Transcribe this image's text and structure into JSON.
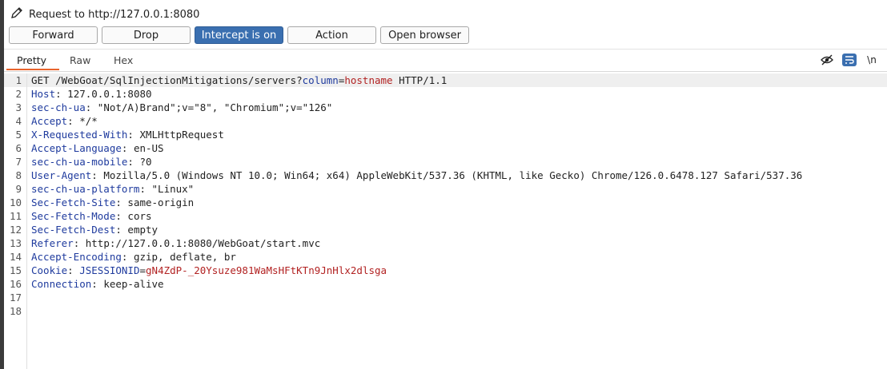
{
  "title": "Request to http://127.0.0.1:8080",
  "toolbar": {
    "buttons": [
      {
        "label": "Forward"
      },
      {
        "label": "Drop"
      },
      {
        "label": "Intercept is on"
      },
      {
        "label": "Action"
      },
      {
        "label": "Open browser"
      }
    ]
  },
  "tabs": [
    {
      "label": "Pretty"
    },
    {
      "label": "Raw"
    },
    {
      "label": "Hex"
    }
  ],
  "icons": {
    "eye_off": "eye-off-icon",
    "wrap": "word-wrap-icon",
    "newline_label": "\\n"
  },
  "colors": {
    "accent": "#e8642c",
    "intercept_button": "#3a6fb0",
    "header_key": "#1f3b9e",
    "param_value": "#b22222"
  },
  "editor": {
    "line_numbers": [
      "1",
      "2",
      "3",
      "4",
      "5",
      "6",
      "7",
      "8",
      "9",
      "10",
      "11",
      "12",
      "13",
      "14",
      "15",
      "16",
      "17",
      "18"
    ],
    "request_line": {
      "method_path": "GET /WebGoat/SqlInjectionMitigations/servers?",
      "param_name": "column",
      "eq": "=",
      "param_value": "hostname",
      "protocol": " HTTP/1.1"
    },
    "headers": [
      {
        "key": "Host",
        "value": "127.0.0.1:8080"
      },
      {
        "key": "sec-ch-ua",
        "value": "\"Not/A)Brand\";v=\"8\", \"Chromium\";v=\"126\""
      },
      {
        "key": "Accept",
        "value": "*/*"
      },
      {
        "key": "X-Requested-With",
        "value": "XMLHttpRequest"
      },
      {
        "key": "Accept-Language",
        "value": "en-US"
      },
      {
        "key": "sec-ch-ua-mobile",
        "value": "?0"
      },
      {
        "key": "User-Agent",
        "value": "Mozilla/5.0 (Windows NT 10.0; Win64; x64) AppleWebKit/537.36 (KHTML, like Gecko) Chrome/126.0.6478.127 Safari/537.36"
      },
      {
        "key": "sec-ch-ua-platform",
        "value": "\"Linux\""
      },
      {
        "key": "Sec-Fetch-Site",
        "value": "same-origin"
      },
      {
        "key": "Sec-Fetch-Mode",
        "value": "cors"
      },
      {
        "key": "Sec-Fetch-Dest",
        "value": "empty"
      },
      {
        "key": "Referer",
        "value": "http://127.0.0.1:8080/WebGoat/start.mvc"
      },
      {
        "key": "Accept-Encoding",
        "value": "gzip, deflate, br"
      }
    ],
    "cookie": {
      "key": "Cookie",
      "name": "JSESSIONID",
      "value": "gN4ZdP-_20Ysuze981WaMsHFtKTn9JnHlx2dlsga"
    },
    "last_header": {
      "key": "Connection",
      "value": "keep-alive"
    },
    "separator": ": "
  }
}
